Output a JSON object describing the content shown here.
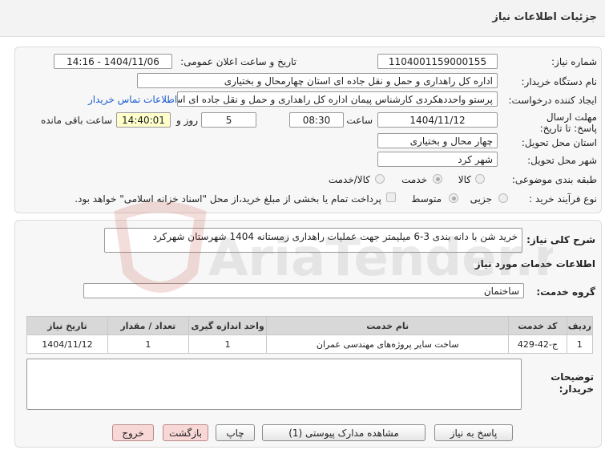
{
  "title": "جزئیات اطلاعات نیاز",
  "watermark_text": "AriaTender.net",
  "fields": {
    "need_number_label": "شماره نیاز:",
    "need_number": "1104001159000155",
    "announce_label": "تاریخ و ساعت اعلان عمومی:",
    "announce_value": "1404/11/06 - 14:16",
    "buyer_org_label": "نام دستگاه خریدار:",
    "buyer_org": "اداره کل راهداری و حمل و نقل جاده ای استان چهارمحال و بختیاری",
    "creator_label": "ایجاد کننده درخواست:",
    "creator": "پرستو واحددهکردی کارشناس پیمان اداره کل راهداری و حمل و نقل جاده ای اس",
    "contact_link": "اطلاعات تماس خریدار",
    "deadline_label": "مهلت ارسال پاسخ: تا تاریخ:",
    "deadline_date": "1404/11/12",
    "time_label": "ساعت",
    "deadline_time": "08:30",
    "days_value": "5",
    "days_label": "روز و",
    "remaining_time": "14:40:01",
    "remaining_label": "ساعت باقی مانده",
    "province_label": "استان محل تحویل:",
    "province": "چهار محال و بختیاری",
    "city_label": "شهر محل تحویل:",
    "city": "شهر کرد",
    "category_label": "طبقه بندی موضوعی:",
    "category_options": [
      "کالا",
      "خدمت",
      "کالا/خدمت"
    ],
    "purchase_type_label": "نوع فرآیند خرید :",
    "purchase_options": [
      "جزیی",
      "متوسط"
    ],
    "payment_note": "پرداخت تمام یا بخشی از مبلغ خرید،از محل \"اسناد خزانه اسلامی\" خواهد بود."
  },
  "description": {
    "label": "شرح کلی نیاز:",
    "value": "خرید شن با دانه بندی 3-6 میلیمتر جهت عملیات راهداری زمستانه 1404 شهرستان شهرکرد"
  },
  "services": {
    "heading": "اطلاعات خدمات مورد نیاز",
    "group_label": "گروه خدمت:",
    "group_value": "ساختمان",
    "columns": [
      "ردیف",
      "کد خدمت",
      "نام خدمت",
      "واحد اندازه گیری",
      "تعداد / مقدار",
      "تاریخ نیاز"
    ],
    "rows": [
      [
        "1",
        "ج-42-429",
        "ساخت سایر پروژه‌های مهندسی عمران",
        "1",
        "1",
        "1404/11/12"
      ]
    ]
  },
  "buyer_notes_label": "توضیحات خریدار:",
  "buttons": {
    "reply": "پاسخ به نیاز",
    "attachments": "مشاهده مدارک پیوستی (1)",
    "print": "چاپ",
    "back": "بازگشت",
    "exit": "خروج"
  }
}
